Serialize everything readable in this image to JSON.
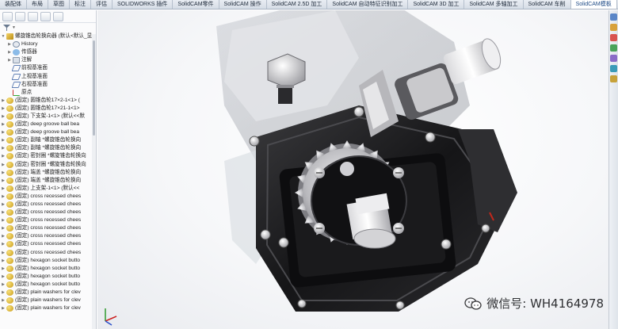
{
  "tabs": [
    "装配体",
    "布局",
    "草图",
    "标注",
    "评估",
    "SOLIDWORKS 插件",
    "SolidCAM零件",
    "SolidCAM 操作",
    "SolidCAM 2.5D 加工",
    "SolidCAM 自动特征识别加工",
    "SolidCAM 3D 加工",
    "SolidCAM 多轴加工",
    "SolidCAM 车削",
    "SolidCAM模板"
  ],
  "active_tab_index": 13,
  "tree": {
    "root": "螺旋锥齿轮换向器 (默认<默认_显",
    "items": [
      {
        "label": "History",
        "icon": "history-icon",
        "level": 2
      },
      {
        "label": "传感器",
        "icon": "sensor-icon",
        "level": 2
      },
      {
        "label": "注解",
        "icon": "annotation-icon",
        "level": 2
      },
      {
        "label": "前视基准面",
        "icon": "plane-icon",
        "level": 2
      },
      {
        "label": "上视基准面",
        "icon": "plane-icon",
        "level": 2
      },
      {
        "label": "右视基准面",
        "icon": "plane-icon",
        "level": 2
      },
      {
        "label": "原点",
        "icon": "origin-icon",
        "level": 2
      },
      {
        "label": "(固定) 圆锥齿轮17×2-1<1> (",
        "icon": "part-icon",
        "level": 1
      },
      {
        "label": "(固定) 圆锥齿轮17×21-1<1>",
        "icon": "part-icon",
        "level": 1
      },
      {
        "label": "(固定) 下支架-1<1> (默认<<默",
        "icon": "part-icon",
        "level": 1
      },
      {
        "label": "(固定) deep groove ball bea",
        "icon": "part-icon",
        "level": 1
      },
      {
        "label": "(固定) deep groove ball bea",
        "icon": "part-icon",
        "level": 1
      },
      {
        "label": "(固定) 副轴 *螺旋锥齿轮换向",
        "icon": "part-icon",
        "level": 1
      },
      {
        "label": "(固定) 副轴 *螺旋锥齿轮换向",
        "icon": "part-icon",
        "level": 1
      },
      {
        "label": "(固定) 密封圈 *螺旋锥齿轮换向",
        "icon": "part-icon",
        "level": 1
      },
      {
        "label": "(固定) 密封圈 *螺旋锥齿轮换向",
        "icon": "part-icon",
        "level": 1
      },
      {
        "label": "(固定) 端盖 *螺旋锥齿轮换向",
        "icon": "part-icon",
        "level": 1
      },
      {
        "label": "(固定) 端盖 *螺旋锥齿轮换向",
        "icon": "part-icon",
        "level": 1
      },
      {
        "label": "(固定) 上支架-1<1> (默认<<",
        "icon": "part-icon",
        "level": 1
      },
      {
        "label": "(固定) cross recessed chees",
        "icon": "part-icon",
        "level": 1
      },
      {
        "label": "(固定) cross recessed chees",
        "icon": "part-icon",
        "level": 1
      },
      {
        "label": "(固定) cross recessed chees",
        "icon": "part-icon",
        "level": 1
      },
      {
        "label": "(固定) cross recessed chees",
        "icon": "part-icon",
        "level": 1
      },
      {
        "label": "(固定) cross recessed chees",
        "icon": "part-icon",
        "level": 1
      },
      {
        "label": "(固定) cross recessed chees",
        "icon": "part-icon",
        "level": 1
      },
      {
        "label": "(固定) cross recessed chees",
        "icon": "part-icon",
        "level": 1
      },
      {
        "label": "(固定) cross recessed chees",
        "icon": "part-icon",
        "level": 1
      },
      {
        "label": "(固定) hexagon socket butto",
        "icon": "part-icon",
        "level": 1
      },
      {
        "label": "(固定) hexagon socket butto",
        "icon": "part-icon",
        "level": 1
      },
      {
        "label": "(固定) hexagon socket butto",
        "icon": "part-icon",
        "level": 1
      },
      {
        "label": "(固定) hexagon socket butto",
        "icon": "part-icon",
        "level": 1
      },
      {
        "label": "(固定) plain washers for clev",
        "icon": "part-icon",
        "level": 1
      },
      {
        "label": "(固定) plain washers for clev",
        "icon": "part-icon",
        "level": 1
      },
      {
        "label": "(固定) plain washers for clev",
        "icon": "part-icon",
        "level": 1
      }
    ]
  },
  "watermark": {
    "text": "微信号: WH4164978",
    "icon": "wechat-icon"
  },
  "colors": {
    "accent": "#1e4a86",
    "body_dark": "#1c1c1e",
    "gear": "#c9c9cc",
    "shaft": "#e6e6e8"
  }
}
